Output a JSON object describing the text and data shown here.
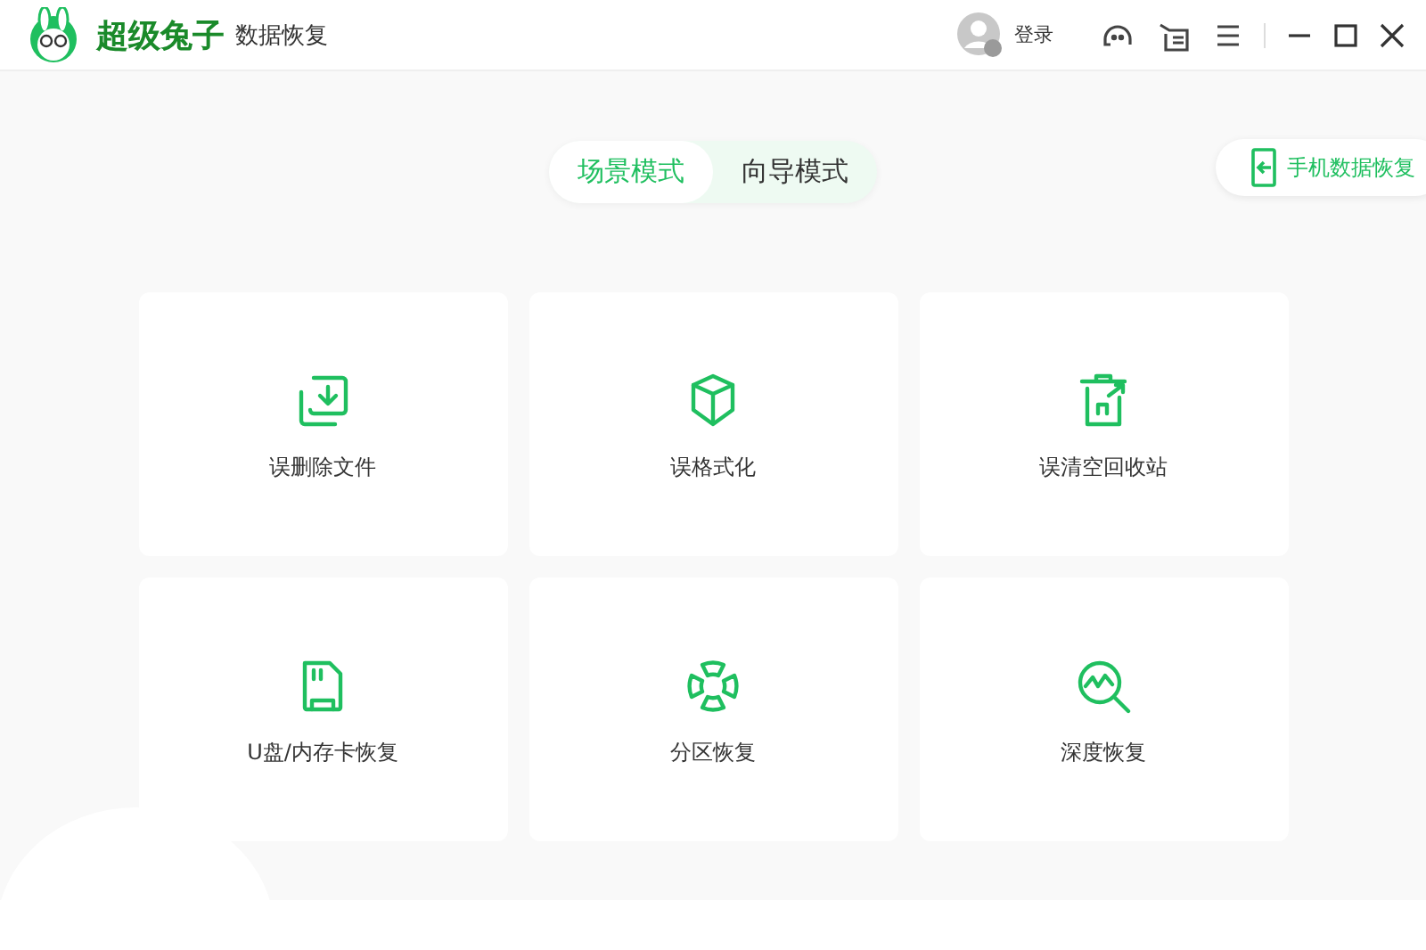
{
  "app": {
    "brand": "超级兔子",
    "product": "数据恢复"
  },
  "header": {
    "login": "登录"
  },
  "mode_tabs": [
    {
      "label": "场景模式",
      "selected": true
    },
    {
      "label": "向导模式",
      "selected": false
    }
  ],
  "phone_button": {
    "label": "手机数据恢复"
  },
  "scenarios": [
    {
      "kind": "deleted",
      "label": "误删除文件"
    },
    {
      "kind": "format",
      "label": "误格式化"
    },
    {
      "kind": "recycle",
      "label": "误清空回收站"
    },
    {
      "kind": "usb",
      "label": "U盘/内存卡恢复"
    },
    {
      "kind": "partition",
      "label": "分区恢复"
    },
    {
      "kind": "deep",
      "label": "深度恢复"
    }
  ]
}
